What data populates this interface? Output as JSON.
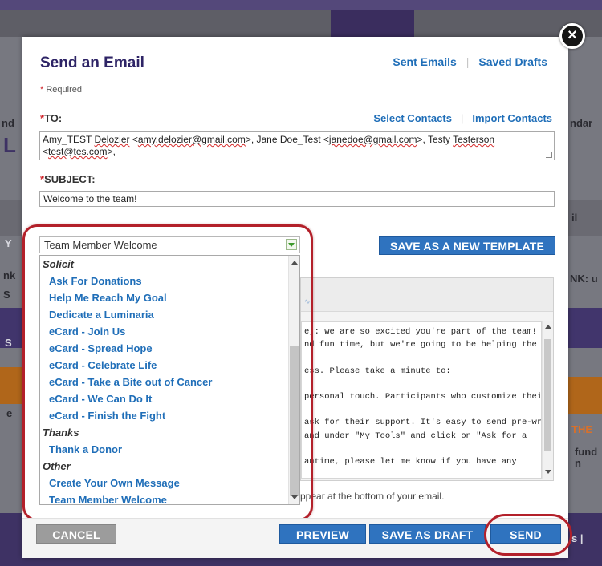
{
  "background": {
    "fragments": [
      "nd",
      "L",
      "Y",
      "nk",
      "S",
      "S",
      "e",
      "ndar",
      "il",
      "NK: u",
      "THE",
      "fund",
      "n",
      "s |"
    ]
  },
  "dialog": {
    "title": "Send an Email",
    "header_links": [
      "Sent Emails",
      "Saved Drafts"
    ],
    "required_label": "Required",
    "close_glyph": "×"
  },
  "to": {
    "label": "TO:",
    "links": [
      "Select Contacts",
      "Import Contacts"
    ],
    "value_parts": [
      {
        "text": "Amy_TEST ",
        "sq": false
      },
      {
        "text": "Delozier",
        "sq": true
      },
      {
        "text": " <",
        "sq": false
      },
      {
        "text": "amy.delozier@gmail.com",
        "sq": true
      },
      {
        "text": ">, Jane Doe_Test <",
        "sq": false
      },
      {
        "text": "janedoe@gmail.com",
        "sq": true
      },
      {
        "text": ">, Testy ",
        "sq": false
      },
      {
        "text": "Testerson",
        "sq": true
      },
      {
        "text": " <",
        "sq": false
      },
      {
        "text": "test@tes.com",
        "sq": true
      },
      {
        "text": ">,",
        "sq": false
      }
    ]
  },
  "subject": {
    "label": "SUBJECT:",
    "value": "Welcome to the team!"
  },
  "template": {
    "selected": "Team Member Welcome",
    "save_template_label": "SAVE AS A NEW TEMPLATE",
    "groups": [
      {
        "label": "Solicit",
        "options": [
          "Ask For Donations",
          "Help Me Reach My Goal",
          "Dedicate a Luminaria",
          "eCard - Join Us",
          "eCard - Spread Hope",
          "eCard - Celebrate Life",
          "eCard - Take a Bite out of Cancer",
          "eCard - We Can Do It",
          "eCard - Finish the Fight"
        ]
      },
      {
        "label": "Thanks",
        "options": [
          "Thank a Donor"
        ]
      },
      {
        "label": "Other",
        "options": [
          "Create Your Own Message",
          "Team Member Welcome"
        ]
      }
    ]
  },
  "editor": {
    "lines": [
      "e,: we are so excited you're part of the team! Our",
      "nd fun time, but we're going to be helping the",
      "",
      "ess. Please take a minute to:",
      "",
      "personal touch. Participants who customize their",
      "",
      "ask for their support. It's easy to send pre-written",
      "and under \"My Tools\" and click on \"Ask for a",
      "",
      "antime, please let me know if you have any"
    ],
    "appear_note": "ppear at the bottom of your email."
  },
  "footer": {
    "cancel_label": "CANCEL",
    "preview_label": "PREVIEW",
    "save_draft_label": "SAVE AS DRAFT",
    "send_label": "SEND"
  },
  "colors": {
    "title": "#2e2466",
    "link": "#1f6eb8",
    "button_blue": "#2f73bf",
    "button_gray": "#9c9c9c",
    "highlight_ring": "#b3202a",
    "required_star": "#d0242b"
  }
}
